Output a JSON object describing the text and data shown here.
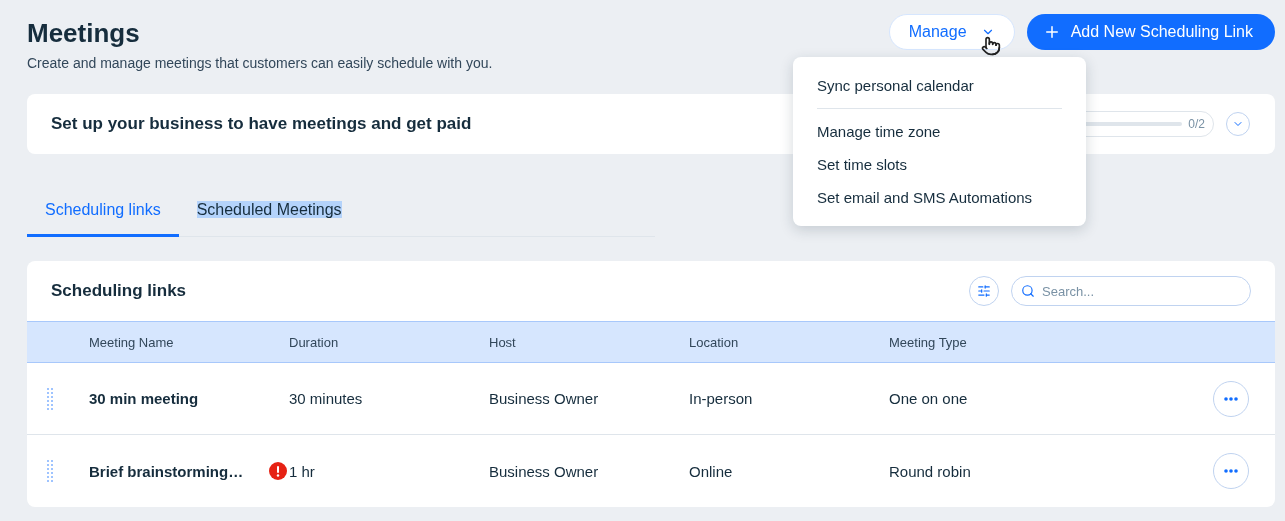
{
  "header": {
    "title": "Meetings",
    "subtitle": "Create and manage meetings that customers can easily schedule with you."
  },
  "manage_button": {
    "label": "Manage",
    "expanded": true
  },
  "add_button": {
    "label": "Add New Scheduling Link"
  },
  "manage_menu": [
    {
      "label": "Sync personal calendar",
      "divider_after": true
    },
    {
      "label": "Manage time zone",
      "divider_after": false
    },
    {
      "label": "Set time slots",
      "divider_after": false
    },
    {
      "label": "Set email and SMS Automations",
      "divider_after": false
    }
  ],
  "setup_card": {
    "title": "Set up your business to have meetings and get paid",
    "progress_text": "0/2",
    "level": 0
  },
  "tabs": [
    {
      "label": "Scheduling links",
      "selected": true,
      "text_highlighted": false
    },
    {
      "label": "Scheduled Meetings",
      "selected": false,
      "text_highlighted": true
    }
  ],
  "table": {
    "title": "Scheduling links",
    "search_placeholder": "Search...",
    "columns": [
      "Meeting Name",
      "Duration",
      "Host",
      "Location",
      "Meeting Type"
    ],
    "rows": [
      {
        "cells": [
          "30 min meeting",
          "30 minutes",
          "Business Owner",
          "In-person",
          "One on one"
        ],
        "warning": false
      },
      {
        "cells": [
          "Brief brainstorming…",
          "1 hr",
          "Business Owner",
          "Online",
          "Round robin"
        ],
        "warning": true
      }
    ]
  }
}
